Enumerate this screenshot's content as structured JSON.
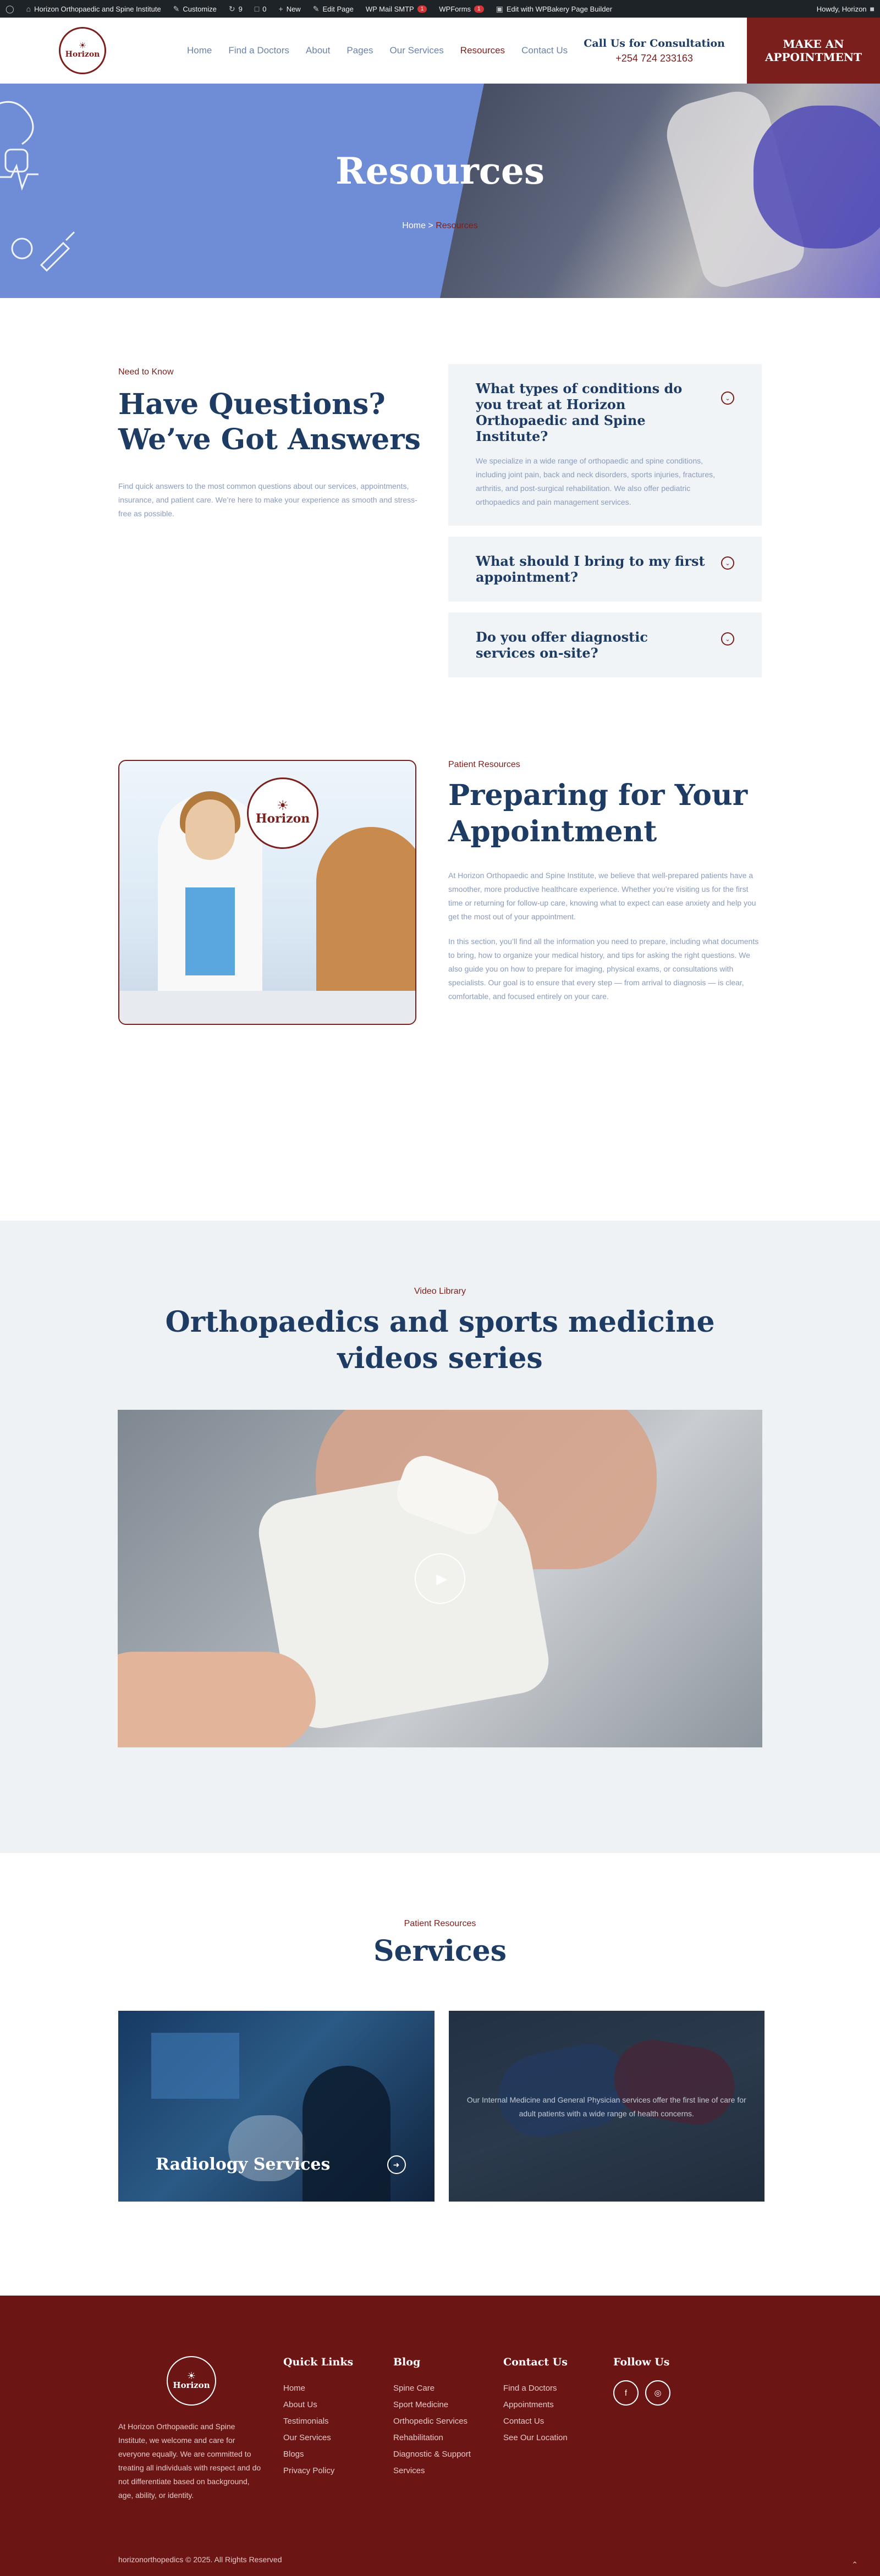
{
  "adminbar": {
    "site": "Horizon Orthopaedic and Spine Institute",
    "customize": "Customize",
    "updates": "9",
    "comments": "0",
    "new": "New",
    "edit_page": "Edit Page",
    "smtp": "WP Mail SMTP",
    "smtp_badge": "1",
    "wpforms": "WPForms",
    "wpforms_badge": "1",
    "wpbakery": "Edit with WPBakery Page Builder",
    "howdy": "Howdy, Horizon"
  },
  "header": {
    "logo_name": "Horizon",
    "nav": [
      "Home",
      "Find a Doctors",
      "About",
      "Pages",
      "Our Services",
      "Resources",
      "Contact Us"
    ],
    "active_nav": "Resources",
    "call_title": "Call Us for Consultation",
    "call_phone": "+254 724 233163",
    "cta_line1": "MAKE AN",
    "cta_line2": "APPOINTMENT"
  },
  "hero": {
    "title": "Resources",
    "crumb_home": "Home",
    "crumb_sep": ">",
    "crumb_current": "Resources"
  },
  "faq": {
    "eyebrow": "Need to Know",
    "title_line1": "Have Questions?",
    "title_line2": "We’ve Got Answers",
    "intro": "Find quick answers to the most common questions about our services, appointments, insurance, and patient care. We’re here to make your experience as smooth and stress-free as possible.",
    "items": [
      {
        "q": "What types of conditions do you treat at Horizon Orthopaedic and Spine Institute?",
        "a": "We specialize in a wide range of orthopaedic and spine conditions, including joint pain, back and neck disorders, sports injuries, fractures, arthritis, and post-surgical rehabilitation. We also offer pediatric orthopaedics and pain management services."
      },
      {
        "q": "What should I bring to my first appointment?"
      },
      {
        "q": "Do you offer diagnostic services on-site?"
      }
    ]
  },
  "prep": {
    "image_logo": "Horizon",
    "eyebrow": "Patient Resources",
    "title_line1": "Preparing for Your",
    "title_line2": "Appointment",
    "p1": "At Horizon Orthopaedic and Spine Institute, we believe that well-prepared patients have a smoother, more productive healthcare experience. Whether you’re visiting us for the first time or returning for follow-up care, knowing what to expect can ease anxiety and help you get the most out of your appointment.",
    "p2": "In this section, you’ll find all the information you need to prepare, including what documents to bring, how to organize your medical history, and tips for asking the right questions. We also guide you on how to prepare for imaging, physical exams, or consultations with specialists. Our goal is to ensure that every step — from arrival to diagnosis — is clear, comfortable, and focused entirely on your care."
  },
  "video": {
    "eyebrow": "Video Library",
    "title_line1": "Orthopaedics and sports medicine",
    "title_line2": "videos series"
  },
  "services": {
    "eyebrow": "Patient Resources",
    "title": "Services",
    "card1_title": "Radiology Services",
    "card2_text": "Our Internal Medicine and General Physician services offer the first line of care for adult patients with a wide range of health concerns."
  },
  "footer": {
    "logo_name": "Horizon",
    "desc": "At Horizon Orthopaedic and Spine Institute, we welcome and care for everyone equally. We are committed to treating all individuals with respect and do not differentiate based on background, age, ability, or identity.",
    "quick_links_title": "Quick Links",
    "quick_links": [
      "Home",
      "About Us",
      "Testimonials",
      "Our Services",
      "Blogs",
      "Privacy Policy"
    ],
    "blog_title": "Blog",
    "blog_links": [
      "Spine Care",
      "Sport Medicine",
      "Orthopedic Services",
      "Rehabilitation",
      "Diagnostic & Support Services"
    ],
    "contact_title": "Contact Us",
    "contact_links": [
      "Find a Doctors",
      "Appointments",
      "Contact Us",
      "See Our Location"
    ],
    "follow_title": "Follow Us",
    "social": [
      "f",
      "◎"
    ],
    "copyright": "horizonorthopedics © 2025. All Rights Reserved"
  }
}
